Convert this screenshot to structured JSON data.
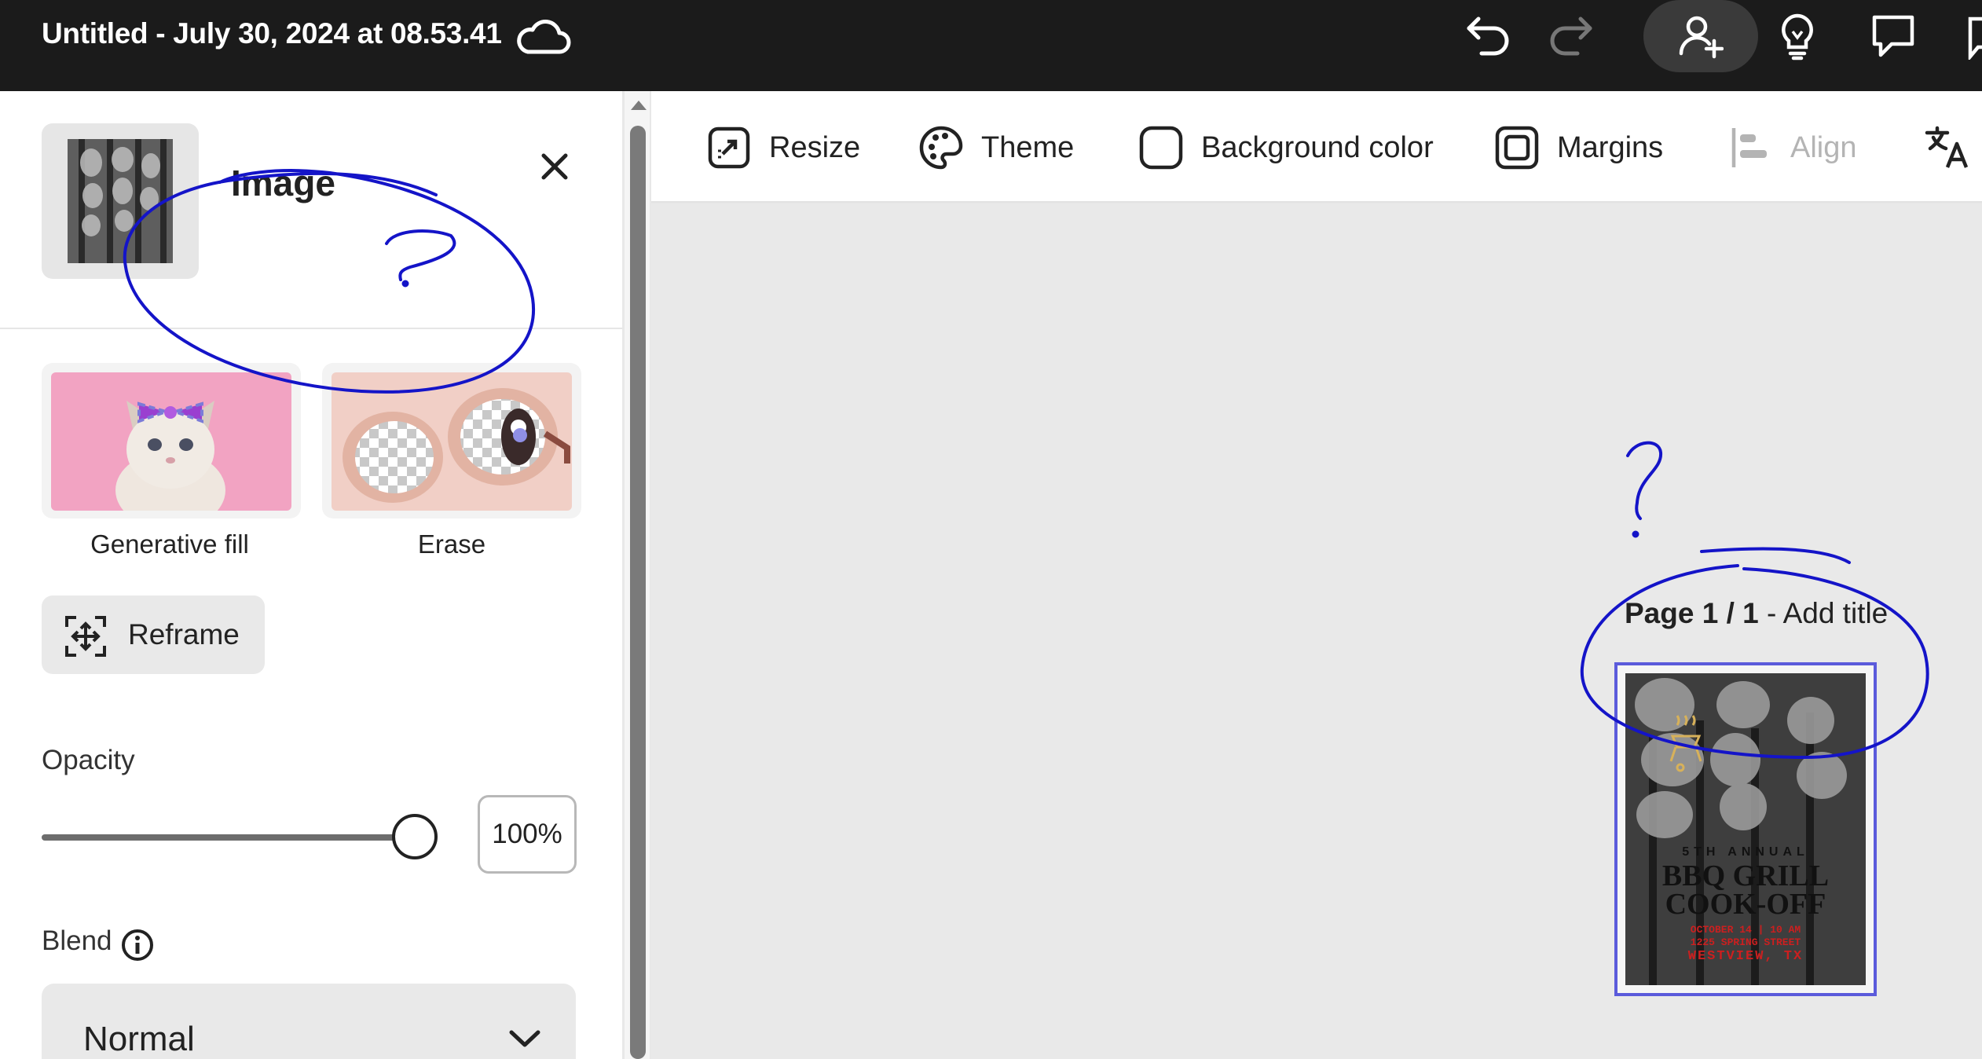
{
  "titlebar": {
    "doc_title": "Untitled - July 30, 2024 at 08.53.41",
    "icons": [
      "cloud-icon",
      "undo-icon",
      "redo-icon",
      "invite-icon",
      "lightbulb-icon",
      "comment-icon"
    ]
  },
  "panel": {
    "title": "Image",
    "cards": [
      {
        "label": "Generative fill"
      },
      {
        "label": "Erase"
      }
    ],
    "reframe_label": "Reframe",
    "opacity_label": "Opacity",
    "opacity_value": "100%",
    "opacity_level": 1.0,
    "blend_label": "Blend",
    "blend_value": "Normal"
  },
  "toolbar": {
    "items": [
      {
        "label": "Resize",
        "icon": "resize-icon"
      },
      {
        "label": "Theme",
        "icon": "palette-icon"
      },
      {
        "label": "Background color",
        "icon": "background-color-icon"
      },
      {
        "label": "Margins",
        "icon": "margins-icon"
      },
      {
        "label": "Align",
        "icon": "align-icon",
        "disabled": true
      },
      {
        "label": "",
        "icon": "translate-icon"
      }
    ]
  },
  "canvas": {
    "page_number": "Page 1 / 1",
    "page_title_separator": " - ",
    "page_title_placeholder": "Add title",
    "page_text": {
      "line1": "5TH ANNUAL",
      "line2": "BBQ GRILL",
      "line3": "COOK-OFF",
      "line4": "OCTOBER 14 | 10 AM",
      "line5": "1225 SPRING STREET",
      "line6": "WESTVIEW, TX"
    }
  },
  "colors": {
    "titlebar_bg": "#1b1b1b",
    "selection_frame": "#5b5bdb",
    "annotation": "#1414c8",
    "poster_red": "#cc1f1f"
  }
}
